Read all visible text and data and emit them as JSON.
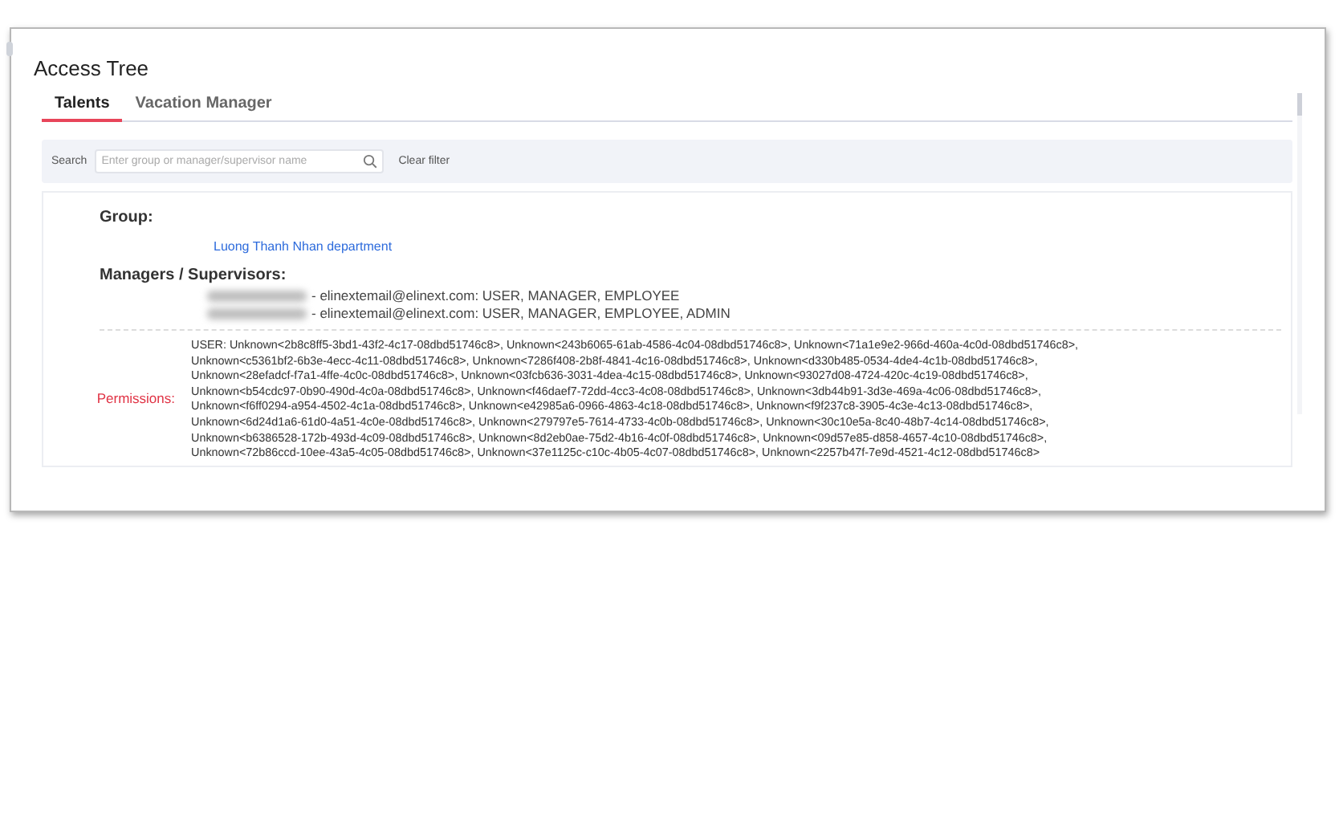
{
  "window": {
    "title": "Access Tree"
  },
  "tabs": [
    {
      "label": "Talents",
      "selected": true
    },
    {
      "label": "Vacation Manager",
      "selected": false
    }
  ],
  "search": {
    "label": "Search",
    "placeholder": "Enter group or manager/supervisor name",
    "clear": "Clear filter"
  },
  "group": {
    "label": "Group:",
    "name": "Luong Thanh Nhan department"
  },
  "managers": {
    "label": "Managers / Supervisors:",
    "items": [
      {
        "contact": "- elinextemail@elinext.com:  USER, MANAGER, EMPLOYEE"
      },
      {
        "contact": "- elinextemail@elinext.com:  USER, MANAGER, EMPLOYEE, ADMIN"
      }
    ]
  },
  "permissions": {
    "label": "Permissions:",
    "lines": [
      "USER: Unknown<2b8c8ff5-3bd1-43f2-4c17-08dbd51746c8>, Unknown<243b6065-61ab-4586-4c04-08dbd51746c8>, Unknown<71a1e9e2-966d-460a-4c0d-08dbd51746c8>,",
      "Unknown<c5361bf2-6b3e-4ecc-4c11-08dbd51746c8>, Unknown<7286f408-2b8f-4841-4c16-08dbd51746c8>, Unknown<d330b485-0534-4de4-4c1b-08dbd51746c8>,",
      "Unknown<28efadcf-f7a1-4ffe-4c0c-08dbd51746c8>, Unknown<03fcb636-3031-4dea-4c15-08dbd51746c8>, Unknown<93027d08-4724-420c-4c19-08dbd51746c8>,",
      "Unknown<b54cdc97-0b90-490d-4c0a-08dbd51746c8>, Unknown<f46daef7-72dd-4cc3-4c08-08dbd51746c8>, Unknown<3db44b91-3d3e-469a-4c06-08dbd51746c8>,",
      "Unknown<f6ff0294-a954-4502-4c1a-08dbd51746c8>, Unknown<e42985a6-0966-4863-4c18-08dbd51746c8>, Unknown<f9f237c8-3905-4c3e-4c13-08dbd51746c8>,",
      "Unknown<6d24d1a6-61d0-4a51-4c0e-08dbd51746c8>, Unknown<279797e5-7614-4733-4c0b-08dbd51746c8>, Unknown<30c10e5a-8c40-48b7-4c14-08dbd51746c8>,",
      "Unknown<b6386528-172b-493d-4c09-08dbd51746c8>, Unknown<8d2eb0ae-75d2-4b16-4c0f-08dbd51746c8>, Unknown<09d57e85-d858-4657-4c10-08dbd51746c8>,",
      "Unknown<72b86ccd-10ee-43a5-4c05-08dbd51746c8>, Unknown<37e1125c-c10c-4b05-4c07-08dbd51746c8>, Unknown<2257b47f-7e9d-4521-4c12-08dbd51746c8>"
    ]
  }
}
